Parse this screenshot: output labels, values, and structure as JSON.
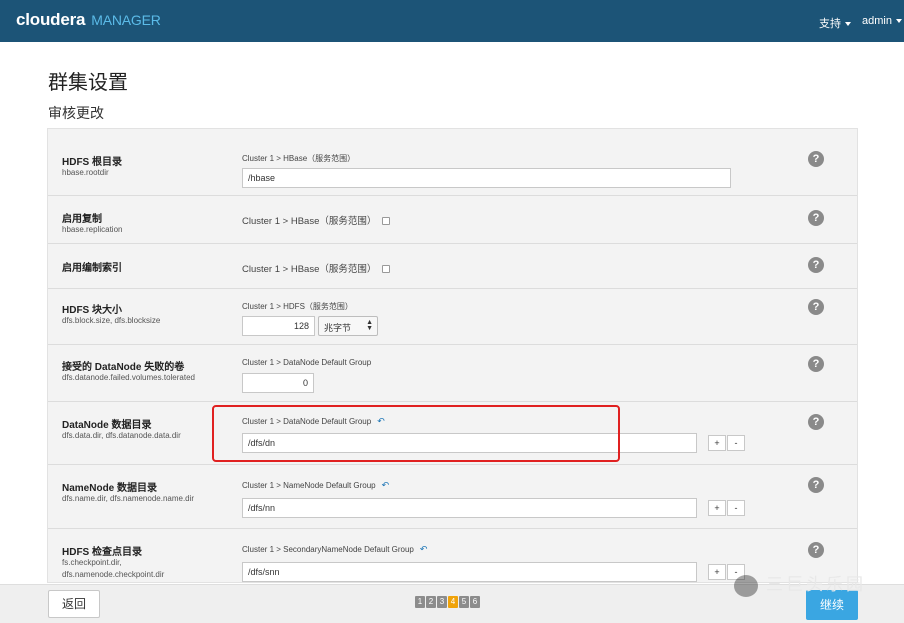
{
  "header": {
    "brand": "cloudera",
    "product": "MANAGER",
    "support_label": "支持",
    "user_label": "admin"
  },
  "page": {
    "title": "群集设置",
    "subtitle": "审核更改"
  },
  "settings": [
    {
      "label": "HDFS 根目录",
      "key": "hbase.rootdir",
      "scope": "Cluster 1 > HBase（服务范围）",
      "value": "/hbase"
    },
    {
      "label": "启用复制",
      "key": "hbase.replication",
      "scope": "Cluster 1 > HBase（服务范围）"
    },
    {
      "label": "启用编制索引",
      "key": "",
      "scope": "Cluster 1 > HBase（服务范围）"
    },
    {
      "label": "HDFS 块大小",
      "key": "dfs.block.size, dfs.blocksize",
      "scope": "Cluster 1 > HDFS（服务范围）",
      "value": "128",
      "unit": "兆字节"
    },
    {
      "label": "接受的 DataNode 失败的卷",
      "key": "dfs.datanode.failed.volumes.tolerated",
      "scope": "Cluster 1 > DataNode Default Group",
      "value": "0"
    },
    {
      "label": "DataNode 数据目录",
      "key": "dfs.data.dir, dfs.datanode.data.dir",
      "scope": "Cluster 1 > DataNode Default Group",
      "value": "/dfs/dn"
    },
    {
      "label": "NameNode 数据目录",
      "key": "dfs.name.dir, dfs.namenode.name.dir",
      "scope": "Cluster 1 > NameNode Default Group",
      "value": "/dfs/nn"
    },
    {
      "label": "HDFS 检查点目录",
      "key_line1": "fs.checkpoint.dir,",
      "key_line2": "dfs.namenode.checkpoint.dir",
      "scope": "Cluster 1 > SecondaryNameNode Default Group",
      "value": "/dfs/snn"
    }
  ],
  "icons": {
    "help": "?",
    "undo": "↶",
    "plus": "+",
    "minus": "-"
  },
  "footer": {
    "back_label": "返回",
    "next_label": "继续",
    "steps": [
      "1",
      "2",
      "3",
      "4",
      "5",
      "6"
    ],
    "current_step": "4"
  },
  "watermark": "三巨头乐园",
  "colors": {
    "header": "#1c5477",
    "accent": "#3aa6e2",
    "highlight": "#e02020",
    "current_step": "#f0a30a"
  }
}
